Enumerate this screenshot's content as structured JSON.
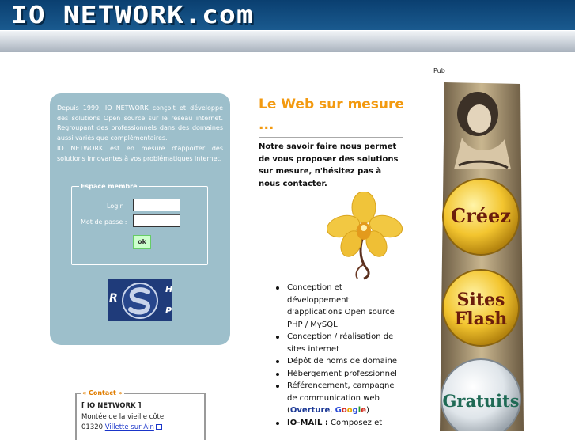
{
  "header": {
    "logo_text": "IO NETWORK.com"
  },
  "intro": {
    "paragraph1": "Depuis 1999, IO NETWORK conçoit et développe des solutions Open source sur le réseau internet. Regroupant des professionnels dans des domaines aussi variés que complémentaires.",
    "paragraph2": "IO NETWORK est en mesure d'apporter des solutions innovantes à vos problématiques internet."
  },
  "member": {
    "legend": "Espace membre",
    "login_label": "Login :",
    "password_label": "Mot de passe :",
    "login_value": "",
    "password_value": "",
    "ok_label": "ok"
  },
  "badge": {
    "letter_left": "R",
    "letter_top": "H",
    "letter_bottom": "P"
  },
  "contact": {
    "legend": "« Contact »",
    "company": "[ IO NETWORK ]",
    "address_line": "Montée de la vieille côte",
    "postcode": "01320",
    "city_link": "Villette sur Ain"
  },
  "center": {
    "title": "Le Web sur mesure ...",
    "lead": "Notre savoir faire nous permet de vous proposer des solutions sur mesure, n'hésitez pas à nous contacter.",
    "services": [
      "Conception et développement d'applications Open source PHP / MySQL",
      "Conception / réalisation de sites internet",
      "Dépôt de noms de domaine",
      "Hébergement professionnel"
    ],
    "seo_prefix": "Référencement, campagne de communication web (",
    "seo_overture": "Overture",
    "seo_sep": ", ",
    "seo_google": [
      "G",
      "o",
      "o",
      "g",
      "l",
      "e"
    ],
    "seo_suffix": ")",
    "iomail_bold": "IO-MAIL :",
    "iomail_text": " Composez et"
  },
  "ad": {
    "label": "Pub",
    "word1": "Créez",
    "word2_line1": "Sites",
    "word2_line2": "Flash",
    "word3": "Gratuits"
  }
}
